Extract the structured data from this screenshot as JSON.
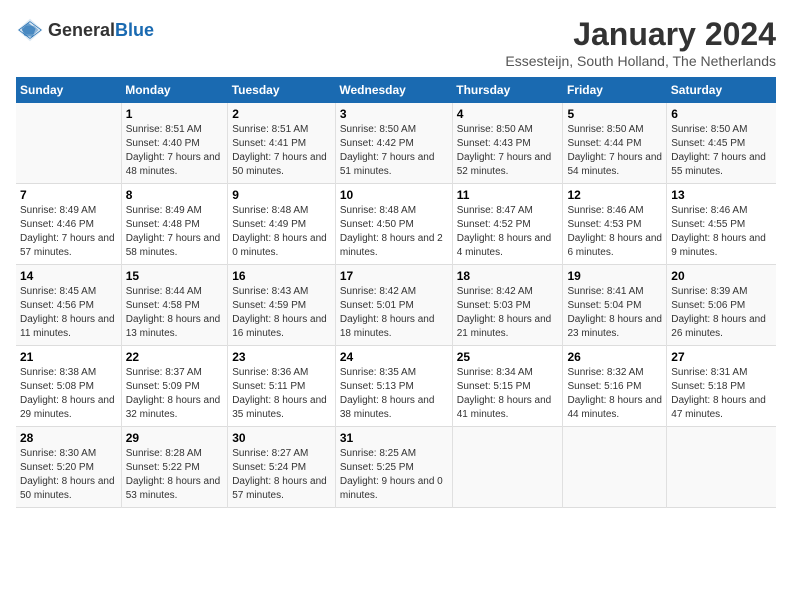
{
  "logo": {
    "general": "General",
    "blue": "Blue"
  },
  "title": "January 2024",
  "subtitle": "Essesteijn, South Holland, The Netherlands",
  "weekdays": [
    "Sunday",
    "Monday",
    "Tuesday",
    "Wednesday",
    "Thursday",
    "Friday",
    "Saturday"
  ],
  "weeks": [
    [
      {
        "day": "",
        "sunrise": "",
        "sunset": "",
        "daylight": ""
      },
      {
        "day": "1",
        "sunrise": "Sunrise: 8:51 AM",
        "sunset": "Sunset: 4:40 PM",
        "daylight": "Daylight: 7 hours and 48 minutes."
      },
      {
        "day": "2",
        "sunrise": "Sunrise: 8:51 AM",
        "sunset": "Sunset: 4:41 PM",
        "daylight": "Daylight: 7 hours and 50 minutes."
      },
      {
        "day": "3",
        "sunrise": "Sunrise: 8:50 AM",
        "sunset": "Sunset: 4:42 PM",
        "daylight": "Daylight: 7 hours and 51 minutes."
      },
      {
        "day": "4",
        "sunrise": "Sunrise: 8:50 AM",
        "sunset": "Sunset: 4:43 PM",
        "daylight": "Daylight: 7 hours and 52 minutes."
      },
      {
        "day": "5",
        "sunrise": "Sunrise: 8:50 AM",
        "sunset": "Sunset: 4:44 PM",
        "daylight": "Daylight: 7 hours and 54 minutes."
      },
      {
        "day": "6",
        "sunrise": "Sunrise: 8:50 AM",
        "sunset": "Sunset: 4:45 PM",
        "daylight": "Daylight: 7 hours and 55 minutes."
      }
    ],
    [
      {
        "day": "7",
        "sunrise": "Sunrise: 8:49 AM",
        "sunset": "Sunset: 4:46 PM",
        "daylight": "Daylight: 7 hours and 57 minutes."
      },
      {
        "day": "8",
        "sunrise": "Sunrise: 8:49 AM",
        "sunset": "Sunset: 4:48 PM",
        "daylight": "Daylight: 7 hours and 58 minutes."
      },
      {
        "day": "9",
        "sunrise": "Sunrise: 8:48 AM",
        "sunset": "Sunset: 4:49 PM",
        "daylight": "Daylight: 8 hours and 0 minutes."
      },
      {
        "day": "10",
        "sunrise": "Sunrise: 8:48 AM",
        "sunset": "Sunset: 4:50 PM",
        "daylight": "Daylight: 8 hours and 2 minutes."
      },
      {
        "day": "11",
        "sunrise": "Sunrise: 8:47 AM",
        "sunset": "Sunset: 4:52 PM",
        "daylight": "Daylight: 8 hours and 4 minutes."
      },
      {
        "day": "12",
        "sunrise": "Sunrise: 8:46 AM",
        "sunset": "Sunset: 4:53 PM",
        "daylight": "Daylight: 8 hours and 6 minutes."
      },
      {
        "day": "13",
        "sunrise": "Sunrise: 8:46 AM",
        "sunset": "Sunset: 4:55 PM",
        "daylight": "Daylight: 8 hours and 9 minutes."
      }
    ],
    [
      {
        "day": "14",
        "sunrise": "Sunrise: 8:45 AM",
        "sunset": "Sunset: 4:56 PM",
        "daylight": "Daylight: 8 hours and 11 minutes."
      },
      {
        "day": "15",
        "sunrise": "Sunrise: 8:44 AM",
        "sunset": "Sunset: 4:58 PM",
        "daylight": "Daylight: 8 hours and 13 minutes."
      },
      {
        "day": "16",
        "sunrise": "Sunrise: 8:43 AM",
        "sunset": "Sunset: 4:59 PM",
        "daylight": "Daylight: 8 hours and 16 minutes."
      },
      {
        "day": "17",
        "sunrise": "Sunrise: 8:42 AM",
        "sunset": "Sunset: 5:01 PM",
        "daylight": "Daylight: 8 hours and 18 minutes."
      },
      {
        "day": "18",
        "sunrise": "Sunrise: 8:42 AM",
        "sunset": "Sunset: 5:03 PM",
        "daylight": "Daylight: 8 hours and 21 minutes."
      },
      {
        "day": "19",
        "sunrise": "Sunrise: 8:41 AM",
        "sunset": "Sunset: 5:04 PM",
        "daylight": "Daylight: 8 hours and 23 minutes."
      },
      {
        "day": "20",
        "sunrise": "Sunrise: 8:39 AM",
        "sunset": "Sunset: 5:06 PM",
        "daylight": "Daylight: 8 hours and 26 minutes."
      }
    ],
    [
      {
        "day": "21",
        "sunrise": "Sunrise: 8:38 AM",
        "sunset": "Sunset: 5:08 PM",
        "daylight": "Daylight: 8 hours and 29 minutes."
      },
      {
        "day": "22",
        "sunrise": "Sunrise: 8:37 AM",
        "sunset": "Sunset: 5:09 PM",
        "daylight": "Daylight: 8 hours and 32 minutes."
      },
      {
        "day": "23",
        "sunrise": "Sunrise: 8:36 AM",
        "sunset": "Sunset: 5:11 PM",
        "daylight": "Daylight: 8 hours and 35 minutes."
      },
      {
        "day": "24",
        "sunrise": "Sunrise: 8:35 AM",
        "sunset": "Sunset: 5:13 PM",
        "daylight": "Daylight: 8 hours and 38 minutes."
      },
      {
        "day": "25",
        "sunrise": "Sunrise: 8:34 AM",
        "sunset": "Sunset: 5:15 PM",
        "daylight": "Daylight: 8 hours and 41 minutes."
      },
      {
        "day": "26",
        "sunrise": "Sunrise: 8:32 AM",
        "sunset": "Sunset: 5:16 PM",
        "daylight": "Daylight: 8 hours and 44 minutes."
      },
      {
        "day": "27",
        "sunrise": "Sunrise: 8:31 AM",
        "sunset": "Sunset: 5:18 PM",
        "daylight": "Daylight: 8 hours and 47 minutes."
      }
    ],
    [
      {
        "day": "28",
        "sunrise": "Sunrise: 8:30 AM",
        "sunset": "Sunset: 5:20 PM",
        "daylight": "Daylight: 8 hours and 50 minutes."
      },
      {
        "day": "29",
        "sunrise": "Sunrise: 8:28 AM",
        "sunset": "Sunset: 5:22 PM",
        "daylight": "Daylight: 8 hours and 53 minutes."
      },
      {
        "day": "30",
        "sunrise": "Sunrise: 8:27 AM",
        "sunset": "Sunset: 5:24 PM",
        "daylight": "Daylight: 8 hours and 57 minutes."
      },
      {
        "day": "31",
        "sunrise": "Sunrise: 8:25 AM",
        "sunset": "Sunset: 5:25 PM",
        "daylight": "Daylight: 9 hours and 0 minutes."
      },
      {
        "day": "",
        "sunrise": "",
        "sunset": "",
        "daylight": ""
      },
      {
        "day": "",
        "sunrise": "",
        "sunset": "",
        "daylight": ""
      },
      {
        "day": "",
        "sunrise": "",
        "sunset": "",
        "daylight": ""
      }
    ]
  ]
}
